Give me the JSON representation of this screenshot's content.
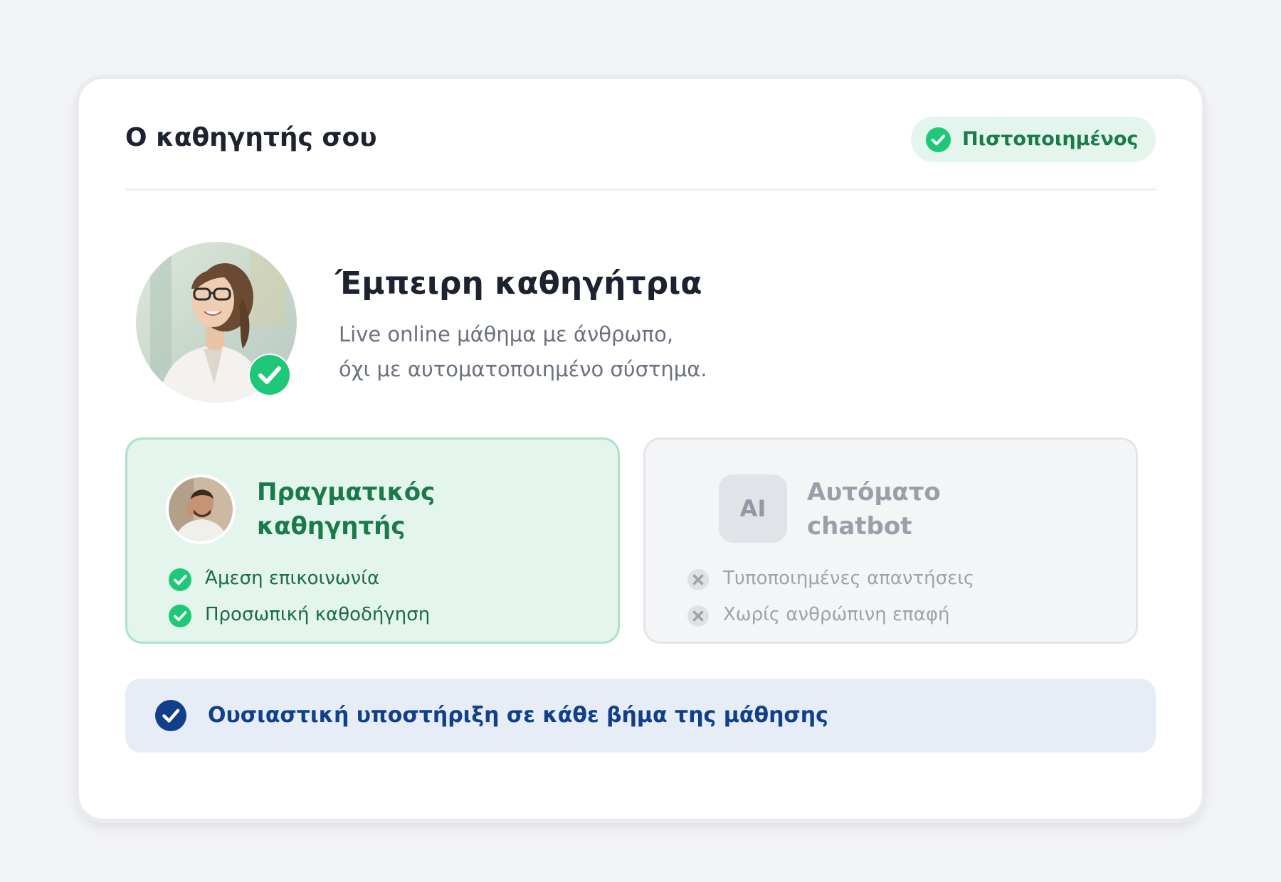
{
  "header": {
    "title": "Ο καθηγητής σου",
    "badge_label": "Πιστοποιημένος"
  },
  "hero": {
    "title": "Έμπειρη καθηγήτρια",
    "subtitle_line1": "Live online μάθημα με άνθρωπο,",
    "subtitle_line2": "όχι με αυτοματοποιημένο σύστημα."
  },
  "real_panel": {
    "title_line1": "Πραγματικός",
    "title_line2": "καθηγητής",
    "features": [
      "Άμεση επικοινωνία",
      "Προσωπική καθοδήγηση"
    ]
  },
  "bot_panel": {
    "icon_text": "AI",
    "title_line1": "Αυτόματο",
    "title_line2": "chatbot",
    "features": [
      "Τυποποιημένες απαντήσεις",
      "Χωρίς ανθρώπινη επαφή"
    ]
  },
  "footer": {
    "label": "Ουσιαστική υποστήριξη σε κάθε βήμα της μάθησης"
  },
  "colors": {
    "accent_green": "#1fc878",
    "dark_green": "#1a7a4c",
    "navy": "#123f8a",
    "muted": "#9ea3ab"
  },
  "icons": {
    "badge": "check-circle-icon",
    "avatar_badge": "check-circle-icon",
    "real_features": "check-circle-icon",
    "bot_features": "x-circle-icon",
    "footer": "check-circle-icon"
  }
}
